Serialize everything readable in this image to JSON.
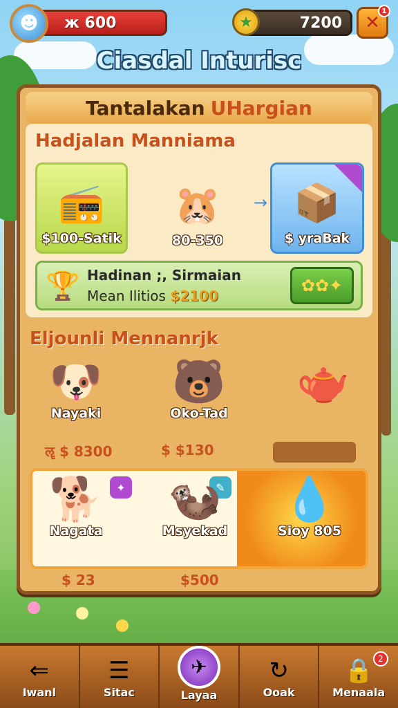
{
  "top_bar": {
    "avatar_icon": "☻",
    "coins": "ж 600",
    "gem_icon": "★",
    "gems": "7200",
    "close_icon": "✕",
    "close_badge": "1"
  },
  "game_title": "Ciasdal Inturisc",
  "panel": {
    "header": "Tantalakan",
    "header_accent": "UHargian",
    "section_a_title": "Hadjalan Manniama",
    "offers": [
      {
        "icon": "📻",
        "caption": "$100-Satik"
      },
      {
        "icon": "🐹",
        "caption": "80-350"
      },
      {
        "icon": "📦",
        "caption": "$ yraBak"
      }
    ],
    "arrow": "→",
    "promo": {
      "icon": "🏆",
      "line1": "Hadinan ;, Sirmaian",
      "line2_text": "Mean Ilitios",
      "line2_price": "$2100",
      "button_icon": "✿✿✦"
    },
    "section_b_title": "Eljounli Mennanrjk",
    "pets_top": [
      {
        "icon": "🐶",
        "name": "Nayaki"
      },
      {
        "icon": "🐻",
        "name": "Oko-Tad"
      },
      {
        "icon": "🫖",
        "name": ""
      }
    ],
    "prices_top": [
      "ॡ $ 8300",
      "$ $130"
    ],
    "pets_bottom": [
      {
        "icon": "🐕",
        "name": "Nagata"
      },
      {
        "icon": "🦦",
        "name": "Msyekad"
      },
      {
        "icon": "💧",
        "name": "Sioy 805"
      }
    ],
    "prices_bottom": [
      "$ 23",
      "$500"
    ]
  },
  "nav": [
    {
      "icon": "⇐",
      "label": "Iwanl"
    },
    {
      "icon": "☰",
      "label": "Sitac"
    },
    {
      "icon": "✈",
      "label": "Layaa"
    },
    {
      "icon": "↻",
      "label": "Ooak"
    },
    {
      "icon": "🔒",
      "label": "Menaala",
      "badge": "2"
    }
  ],
  "colors": {
    "panel_bg": "#e9b565",
    "panel_border": "#8a5423",
    "title_orange": "#c8501a",
    "accent_green": "#7ab048",
    "accent_blue": "#3f8fd6"
  }
}
